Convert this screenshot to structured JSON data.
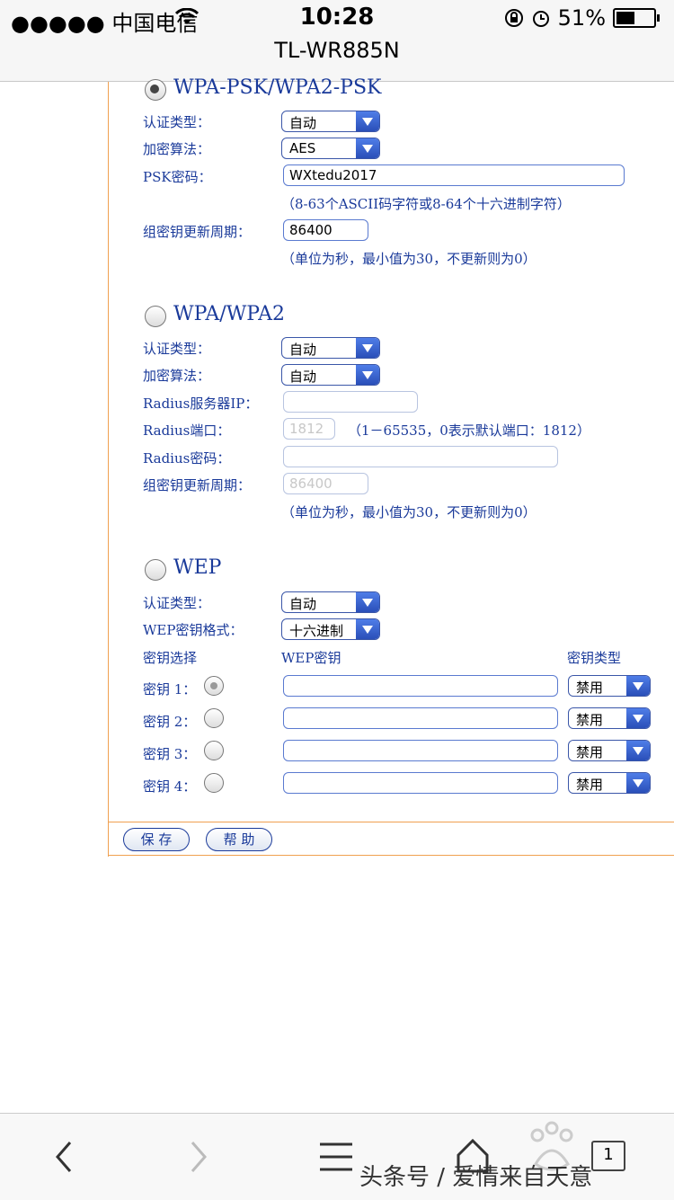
{
  "status_bar": {
    "carrier": "●●●●● 中国电信",
    "time": "10:28",
    "battery_pct": "51%",
    "icons": [
      "wifi-icon",
      "rotation-lock-icon",
      "alarm-icon",
      "battery-icon"
    ]
  },
  "nav": {
    "title": "TL-WR885N"
  },
  "wpa_psk": {
    "title": "WPA-PSK/WPA2-PSK",
    "auth_label": "认证类型：",
    "auth_value": "自动",
    "enc_label": "加密算法：",
    "enc_value": "AES",
    "psk_label": "PSK密码：",
    "psk_value": "WXtedu2017",
    "psk_hint": "（8-63个ASCII码字符或8-64个十六进制字符）",
    "group_label": "组密钥更新周期：",
    "group_value": "86400",
    "group_hint": "（单位为秒，最小值为30，不更新则为0）"
  },
  "wpa": {
    "title": "WPA/WPA2",
    "auth_label": "认证类型：",
    "auth_value": "自动",
    "enc_label": "加密算法：",
    "enc_value": "自动",
    "radius_ip_label": "Radius服务器IP：",
    "radius_ip_value": "",
    "radius_port_label": "Radius端口：",
    "radius_port_value": "1812",
    "radius_port_hint": "（1－65535，0表示默认端口：1812）",
    "radius_pwd_label": "Radius密码：",
    "radius_pwd_value": "",
    "group_label": "组密钥更新周期：",
    "group_value": "86400",
    "group_hint": "（单位为秒，最小值为30，不更新则为0）"
  },
  "wep": {
    "title": "WEP",
    "auth_label": "认证类型：",
    "auth_value": "自动",
    "format_label": "WEP密钥格式：",
    "format_value": "十六进制",
    "col_select": "密钥选择",
    "col_key": "WEP密钥",
    "col_type": "密钥类型",
    "keys": [
      {
        "label": "密钥 1：",
        "value": "",
        "type": "禁用"
      },
      {
        "label": "密钥 2：",
        "value": "",
        "type": "禁用"
      },
      {
        "label": "密钥 3：",
        "value": "",
        "type": "禁用"
      },
      {
        "label": "密钥 4：",
        "value": "",
        "type": "禁用"
      }
    ]
  },
  "buttons": {
    "save": "保 存",
    "help": "帮 助"
  },
  "bottom_bar": {
    "watermark": "头条号 / 爱情来自天意",
    "tab_count": "1",
    "icons": [
      "back-icon",
      "forward-icon",
      "menu-icon",
      "home-icon",
      "tabs-icon"
    ]
  }
}
